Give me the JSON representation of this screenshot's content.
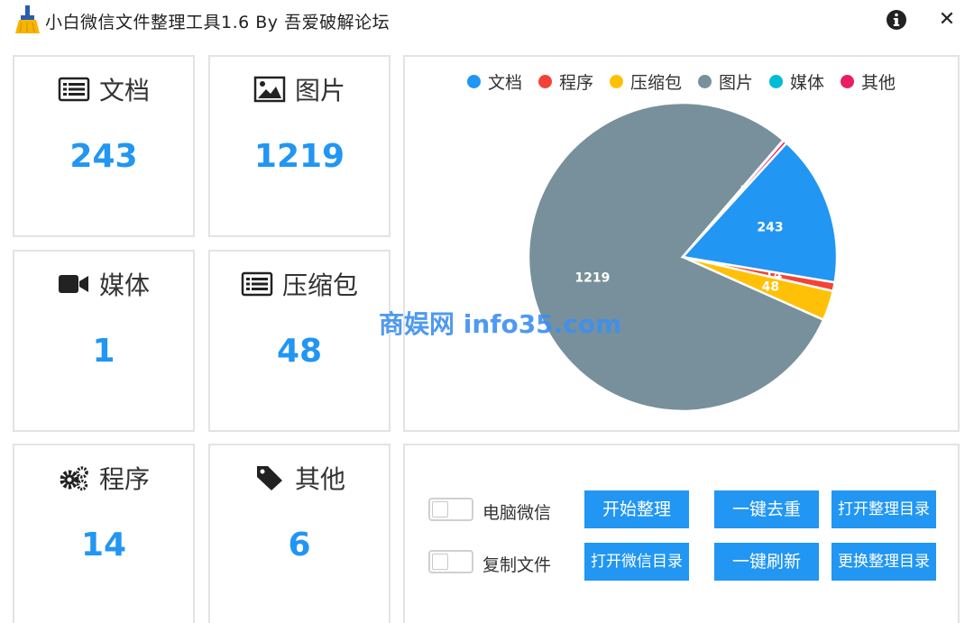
{
  "window": {
    "title": "小白微信文件整理工具1.6 By 吾爱破解论坛"
  },
  "cards": [
    {
      "label": "文档",
      "value": "243",
      "icon": "document-list-icon"
    },
    {
      "label": "图片",
      "value": "1219",
      "icon": "image-icon"
    },
    {
      "label": "媒体",
      "value": "1",
      "icon": "video-camera-icon"
    },
    {
      "label": "压缩包",
      "value": "48",
      "icon": "archive-list-icon"
    },
    {
      "label": "程序",
      "value": "14",
      "icon": "gears-icon"
    },
    {
      "label": "其他",
      "value": "6",
      "icon": "tag-icon"
    }
  ],
  "chart_data": {
    "type": "pie",
    "legend_position": "top",
    "slices": [
      {
        "name": "文档",
        "value": 243,
        "color": "#2196f3",
        "label": "243"
      },
      {
        "name": "程序",
        "value": 14,
        "color": "#f44336",
        "label": "14"
      },
      {
        "name": "压缩包",
        "value": 48,
        "color": "#ffc107",
        "label": "48"
      },
      {
        "name": "图片",
        "value": 1219,
        "color": "#78909c",
        "label": "1219"
      },
      {
        "name": "媒体",
        "value": 1,
        "color": "#00bcd4",
        "label": "1"
      },
      {
        "name": "其他",
        "value": 6,
        "color": "#e91e63",
        "label": "6"
      }
    ]
  },
  "controls": {
    "toggle_pc_wechat": "电脑微信",
    "toggle_copy_files": "复制文件",
    "start_organize": "开始整理",
    "dedupe": "一键去重",
    "open_organize_dir": "打开整理目录",
    "open_wechat_dir": "打开微信目录",
    "refresh": "一键刷新",
    "change_organize_dir": "更换整理目录"
  },
  "watermark": "商娱网 info35.com",
  "colors": {
    "accent": "#2196f3",
    "border": "#e3e3e3"
  }
}
